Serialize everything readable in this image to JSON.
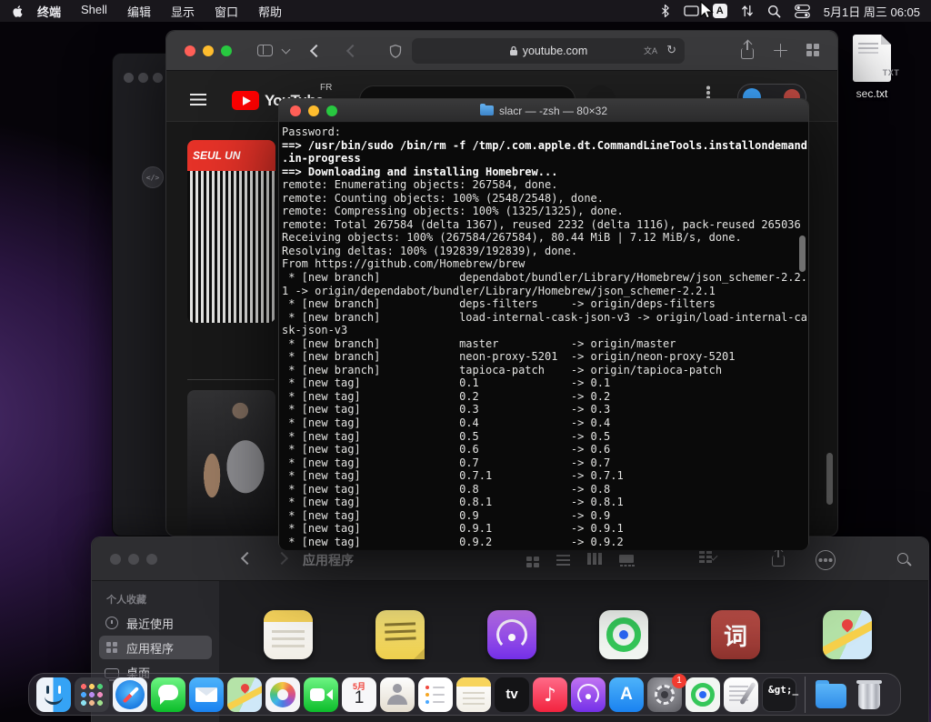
{
  "menu_bar": {
    "app_menu": "终端",
    "menus": [
      {
        "label": "Shell",
        "name": "menu-shell"
      },
      {
        "label": "编辑",
        "name": "menu-edit"
      },
      {
        "label": "显示",
        "name": "menu-view"
      },
      {
        "label": "窗口",
        "name": "menu-window"
      },
      {
        "label": "帮助",
        "name": "menu-help"
      }
    ],
    "input_source": "A",
    "clock": "5月1日 周三 06:05"
  },
  "desktop": {
    "file": {
      "label": "sec.txt",
      "type_badge": "TXT"
    }
  },
  "safari": {
    "address": "youtube.com",
    "youtube": {
      "logo_text": "YouTube",
      "region": "FR",
      "thumbnail_text": "SEUL UN"
    }
  },
  "terminal": {
    "title": "slacr — -zsh — 80×32",
    "lines": [
      {
        "t": "Password:"
      },
      {
        "t": "==> /usr/bin/sudo /bin/rm -f /tmp/.com.apple.dt.CommandLineTools.installondemand",
        "cls": "b"
      },
      {
        "t": ".in-progress",
        "cls": "b"
      },
      {
        "t": "==> Downloading and installing Homebrew...",
        "cls": "b"
      },
      {
        "t": "remote: Enumerating objects: 267584, done."
      },
      {
        "t": "remote: Counting objects: 100% (2548/2548), done."
      },
      {
        "t": "remote: Compressing objects: 100% (1325/1325), done."
      },
      {
        "t": "remote: Total 267584 (delta 1367), reused 2232 (delta 1116), pack-reused 265036"
      },
      {
        "t": "Receiving objects: 100% (267584/267584), 80.44 MiB | 7.12 MiB/s, done."
      },
      {
        "t": "Resolving deltas: 100% (192839/192839), done."
      },
      {
        "t": "From https://github.com/Homebrew/brew"
      },
      {
        "t": " * [new branch]            dependabot/bundler/Library/Homebrew/json_schemer-2.2."
      },
      {
        "t": "1 -> origin/dependabot/bundler/Library/Homebrew/json_schemer-2.2.1"
      },
      {
        "t": " * [new branch]            deps-filters     -> origin/deps-filters"
      },
      {
        "t": " * [new branch]            load-internal-cask-json-v3 -> origin/load-internal-ca"
      },
      {
        "t": "sk-json-v3"
      },
      {
        "t": " * [new branch]            master           -> origin/master"
      },
      {
        "t": " * [new branch]            neon-proxy-5201  -> origin/neon-proxy-5201"
      },
      {
        "t": " * [new branch]            tapioca-patch    -> origin/tapioca-patch"
      },
      {
        "t": " * [new tag]               0.1              -> 0.1"
      },
      {
        "t": " * [new tag]               0.2              -> 0.2"
      },
      {
        "t": " * [new tag]               0.3              -> 0.3"
      },
      {
        "t": " * [new tag]               0.4              -> 0.4"
      },
      {
        "t": " * [new tag]               0.5              -> 0.5"
      },
      {
        "t": " * [new tag]               0.6              -> 0.6"
      },
      {
        "t": " * [new tag]               0.7              -> 0.7"
      },
      {
        "t": " * [new tag]               0.7.1            -> 0.7.1"
      },
      {
        "t": " * [new tag]               0.8              -> 0.8"
      },
      {
        "t": " * [new tag]               0.8.1            -> 0.8.1"
      },
      {
        "t": " * [new tag]               0.9              -> 0.9"
      },
      {
        "t": " * [new tag]               0.9.1            -> 0.9.1"
      },
      {
        "t": " * [new tag]               0.9.2            -> 0.9.2"
      }
    ]
  },
  "finder": {
    "title": "应用程序",
    "sidebar_section": "个人收藏",
    "sidebar_items": [
      {
        "label": "最近使用",
        "kind": "si-recents",
        "name": "sidebar-item-recents"
      },
      {
        "label": "应用程序",
        "kind": "si-apps",
        "name": "sidebar-item-applications",
        "cls": "selected"
      },
      {
        "label": "桌面",
        "kind": "si-desktop",
        "name": "sidebar-item-desktop"
      }
    ],
    "apps": [
      {
        "name": "app-icon-notes",
        "kind": "ic-notes"
      },
      {
        "name": "app-icon-stickies",
        "kind": "ic-stickies"
      },
      {
        "name": "app-icon-podcasts",
        "kind": "ic-podcasts"
      },
      {
        "name": "app-icon-find-my",
        "kind": "ic-findmy"
      },
      {
        "name": "app-icon-dictionary",
        "kind": "ic-dict",
        "glyph": "词"
      },
      {
        "name": "app-icon-maps",
        "kind": "ic-maps"
      }
    ]
  },
  "dock": {
    "items": [
      {
        "name": "dock-item-finder",
        "kind": "di-finder"
      },
      {
        "name": "dock-item-launchpad",
        "kind": "di-launchpad"
      },
      {
        "name": "dock-item-safari",
        "kind": "di-safari"
      },
      {
        "name": "dock-item-messages",
        "kind": "di-messages"
      },
      {
        "name": "dock-item-mail",
        "kind": "di-mail"
      },
      {
        "name": "dock-item-maps",
        "kind": "di-maps"
      },
      {
        "name": "dock-item-photos",
        "kind": "di-photos"
      },
      {
        "name": "dock-item-facetime",
        "kind": "di-facetime"
      },
      {
        "name": "dock-item-calendar",
        "kind": "di-calendar",
        "cal_month": "5月",
        "cal_day": "1"
      },
      {
        "name": "dock-item-contacts",
        "kind": "di-contacts"
      },
      {
        "name": "dock-item-reminders",
        "kind": "di-reminders"
      },
      {
        "name": "dock-item-notes",
        "kind": "di-notes"
      },
      {
        "name": "dock-item-tv",
        "kind": "di-tv",
        "glyph": "tv"
      },
      {
        "name": "dock-item-music",
        "kind": "di-music",
        "glyph": "♪"
      },
      {
        "name": "dock-item-podcasts",
        "kind": "di-podcasts"
      },
      {
        "name": "dock-item-app-store",
        "kind": "di-appstore",
        "glyph": "A"
      },
      {
        "name": "dock-item-system-settings",
        "kind": "di-settings",
        "badge": "1"
      },
      {
        "name": "dock-item-find-my",
        "kind": "di-findmy"
      },
      {
        "name": "dock-item-textedit",
        "kind": "di-textedit"
      },
      {
        "name": "dock-item-terminal",
        "kind": "di-terminal",
        "glyph": "&gt;_"
      },
      {
        "name": "dock-separator",
        "kind": "di-sep"
      },
      {
        "name": "dock-item-downloads",
        "kind": "di-downloads"
      },
      {
        "name": "dock-item-trash",
        "kind": "di-trash"
      }
    ]
  }
}
